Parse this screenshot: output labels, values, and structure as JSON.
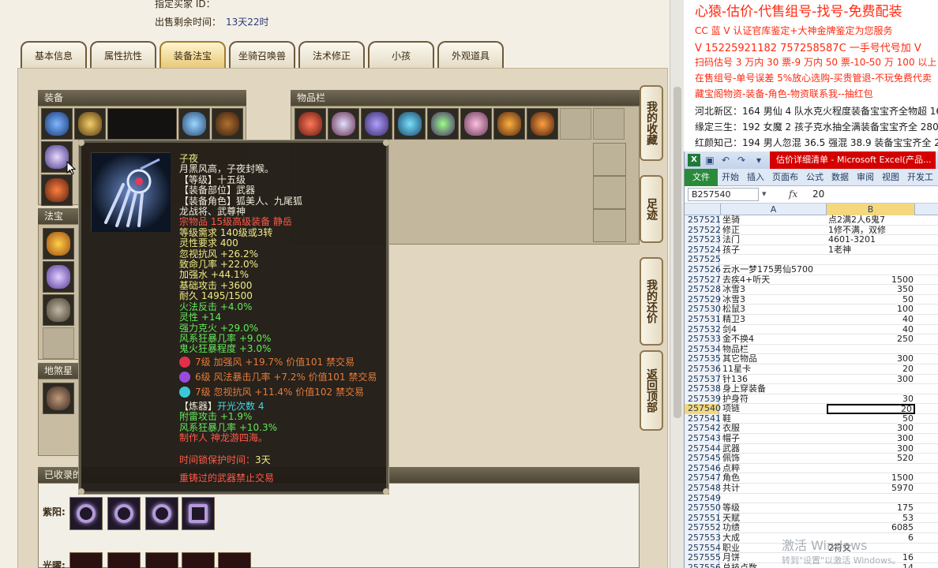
{
  "game": {
    "seller_id_label": "指定买家 ID：",
    "remaining_label": "出售剩余时间：",
    "remaining_value": "13天22时",
    "tabs": [
      "基本信息",
      "属性抗性",
      "装备法宝",
      "坐骑召唤兽",
      "法术修正",
      "小孩",
      "外观道具"
    ],
    "active_tab": 2,
    "panels": {
      "equip": "装备",
      "inventory": "物品栏",
      "fabao": "法宝",
      "dishaxing": "地煞星阶",
      "collected": "已收录的"
    },
    "side_buttons": [
      "我的收藏",
      "足迹",
      "我的还价",
      "返回顶部"
    ],
    "collect_row_label": "紫阳:",
    "collect_row_label2": "光曜:"
  },
  "tooltip": {
    "name": "子夜",
    "desc": "月黑风高，子夜封喉。",
    "level": "【等级】十五级",
    "slot": "【装备部位】武器",
    "roles": "【装备角色】狐美人、九尾狐",
    "roles2": "龙战将、武尊神",
    "special": "宗物品 15级高级装备 静岳",
    "req_level": "等级需求 140级或3转",
    "req_spirit": "灵性要求 400",
    "stats": [
      "忽视抗风 +26.2%",
      "致命几率 +22.0%",
      "加强水 +44.1%",
      "基础攻击 +3600",
      "耐久 1495/1500"
    ],
    "green_stats": [
      "火法反击 +4.0%",
      "灵性 +14",
      "强力克火 +29.0%",
      "风系狂暴几率 +9.0%",
      "鬼火狂暴程度 +3.0%"
    ],
    "gems": [
      {
        "text": "7级 加强风 +19.7% 价值101 禁交易",
        "color": "#e0304a"
      },
      {
        "text": "6级 风法暴击几率 +7.2% 价值101 禁交易",
        "color": "#9a4ae0"
      },
      {
        "text": "7级 忽视抗风 +11.4% 价值102 禁交易",
        "color": "#3ac8d8"
      }
    ],
    "refine_label": "【炼器】",
    "refine_value": "开光次数 4",
    "refine_stats": [
      "附雷攻击 +1.9%",
      "风系狂暴几率 +10.3%"
    ],
    "maker": "制作人 神龙游四海。",
    "protect_label": "时间锁保护时间：",
    "protect_value": "3天",
    "no_trade": "重铸过的武器禁止交易"
  },
  "doc": {
    "title": "心猿-估价-代售组号-找号-免费配装",
    "lines": [
      {
        "text": "CC 蓝 V 认证官库鉴定+大神金牌鉴定为您服务",
        "color": "#ff2a10"
      },
      {
        "text": "V 15225921182    757258587C 一手号代号加 V",
        "color": "#ff2a10"
      },
      {
        "text": "扫码估号 3 万内 30 票-9 万内 50 票-10-50 万 100 以上 150",
        "color": "#ff2a10"
      },
      {
        "text": "在售组号-单号误差 5%放心选购-买贵管退-不玩免费代卖",
        "color": "#ff2a10"
      },
      {
        "text": "藏宝阁物资-装备-角色-物资联系我--抽红包",
        "color": "#ff2a10"
      },
      {
        "text": "河北新区：164 男仙 4 队水克火程度装备宝宝齐全物超 16666",
        "color": "#1a1a1a"
      },
      {
        "text": "缘定三生：192 女魔 2 孩子克水抽全满装备宝宝齐全 28000",
        "color": "#1a1a1a"
      },
      {
        "text": "红颜知己：194 男人忽混 36.5 强混 38.9 装备宝宝齐全 28000",
        "color": "#1a1a1a"
      }
    ]
  },
  "excel": {
    "title": "估价详细清单 - Microsoft Excel(产品...",
    "ribbon_tabs": [
      "文件",
      "开始",
      "插入",
      "页面布",
      "公式",
      "数据",
      "审阅",
      "视图",
      "开发工",
      "更多"
    ],
    "name_box": "B257540",
    "fx": "fx",
    "formula_value": "20",
    "col_headers": [
      "A",
      "B"
    ],
    "selected_row": "257540",
    "rows": [
      [
        "257521",
        "坐骑",
        "点2满2人6鬼7"
      ],
      [
        "257522",
        "修正",
        "1修不满，双修"
      ],
      [
        "257523",
        "法门",
        "4601-3201"
      ],
      [
        "257524",
        "孩子",
        "1老神"
      ],
      [
        "257525",
        "",
        ""
      ],
      [
        "257526",
        "云水一梦175男仙5700",
        ""
      ],
      [
        "257527",
        "去疾4+听天",
        "1500"
      ],
      [
        "257528",
        "冰雪3",
        "350"
      ],
      [
        "257529",
        "冰雪3",
        "50"
      ],
      [
        "257530",
        "松鼠3",
        "100"
      ],
      [
        "257531",
        "精卫3",
        "40"
      ],
      [
        "257532",
        "剑4",
        "40"
      ],
      [
        "257533",
        "金不换4",
        "250"
      ],
      [
        "257534",
        "物品栏",
        ""
      ],
      [
        "257535",
        "其它物品",
        "300"
      ],
      [
        "257536",
        "11星卡",
        "20"
      ],
      [
        "257537",
        "针136",
        "300"
      ],
      [
        "257538",
        "身上穿装备",
        ""
      ],
      [
        "257539",
        "护身符",
        "30"
      ],
      [
        "257540",
        "项链",
        "20"
      ],
      [
        "257541",
        "鞋",
        "50"
      ],
      [
        "257542",
        "衣服",
        "300"
      ],
      [
        "257543",
        "帽子",
        "300"
      ],
      [
        "257544",
        "武器",
        "300"
      ],
      [
        "257545",
        "佩饰",
        "520"
      ],
      [
        "257546",
        "点粹",
        ""
      ],
      [
        "257547",
        "角色",
        "1500"
      ],
      [
        "257548",
        "共计",
        "5970"
      ],
      [
        "257549",
        "",
        ""
      ],
      [
        "257550",
        "等级",
        "175"
      ],
      [
        "257551",
        "天赋",
        "53"
      ],
      [
        "257552",
        "功绩",
        "6085"
      ],
      [
        "257553",
        "大成",
        "6"
      ],
      [
        "257554",
        "职业",
        "2符文"
      ],
      [
        "257555",
        "月饼",
        "16"
      ],
      [
        "257556",
        "总技点数",
        "14"
      ]
    ]
  },
  "watermark": {
    "line1": "激活 Windows",
    "line2": "转到\"设置\"以激活 Windows。"
  },
  "colors": {
    "accent_red": "#ff2a10",
    "tab_active": "#e8c977",
    "excel_green": "#2a8a3a",
    "tooltip_bg": "#211c16"
  }
}
